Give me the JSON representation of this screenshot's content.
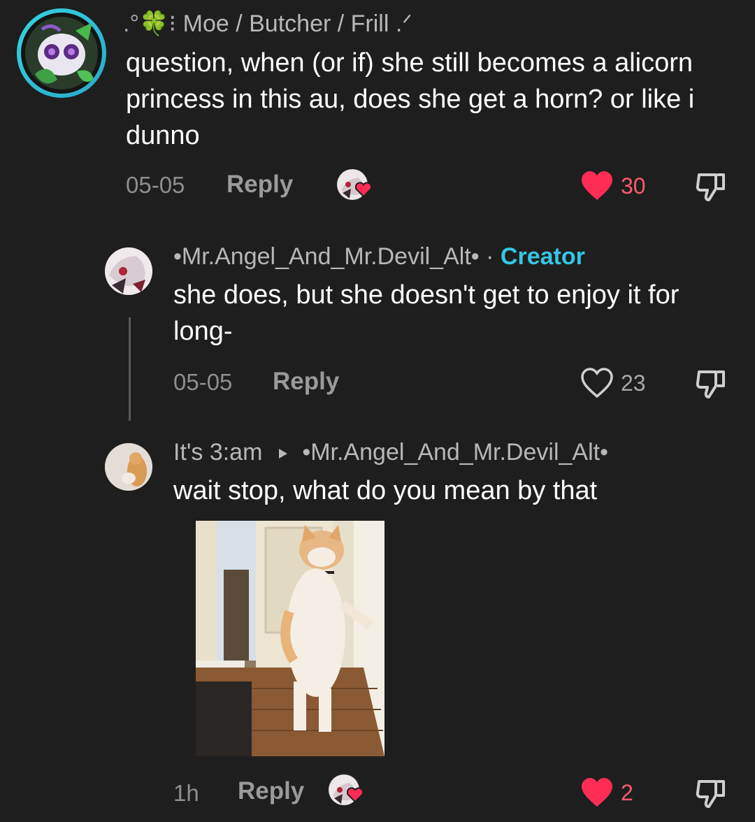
{
  "comments": [
    {
      "username_prefix": ".°🍀⁝",
      "username": "Moe / Butcher / Frill .ᐟ",
      "text": "question, when (or if) she still becomes a alicorn princess in this au, does she get a horn? or like i dunno",
      "date": "05-05",
      "reply_label": "Reply",
      "likes": "30",
      "liked": true
    },
    {
      "username": "•Mr.Angel_And_Mr.Devil_Alt•",
      "separator": "·",
      "badge": "Creator",
      "text": "she does, but she doesn't get to enjoy it for long-",
      "date": "05-05",
      "reply_label": "Reply",
      "likes": "23",
      "liked": false
    },
    {
      "username": "It's 3:am",
      "reply_to": "•Mr.Angel_And_Mr.Devil_Alt•",
      "text": "wait stop, what do you mean by that",
      "date": "1h",
      "reply_label": "Reply",
      "likes": "2",
      "liked": true
    }
  ],
  "icons": {
    "like_filled": "heart-filled-icon",
    "like_outline": "heart-outline-icon",
    "dislike": "thumbs-down-icon",
    "reply_to_arrow": "triangle-right-icon"
  },
  "colors": {
    "background": "#1e1e1e",
    "like_red": "#ff2d55",
    "creator_blue": "#35c6e6"
  }
}
